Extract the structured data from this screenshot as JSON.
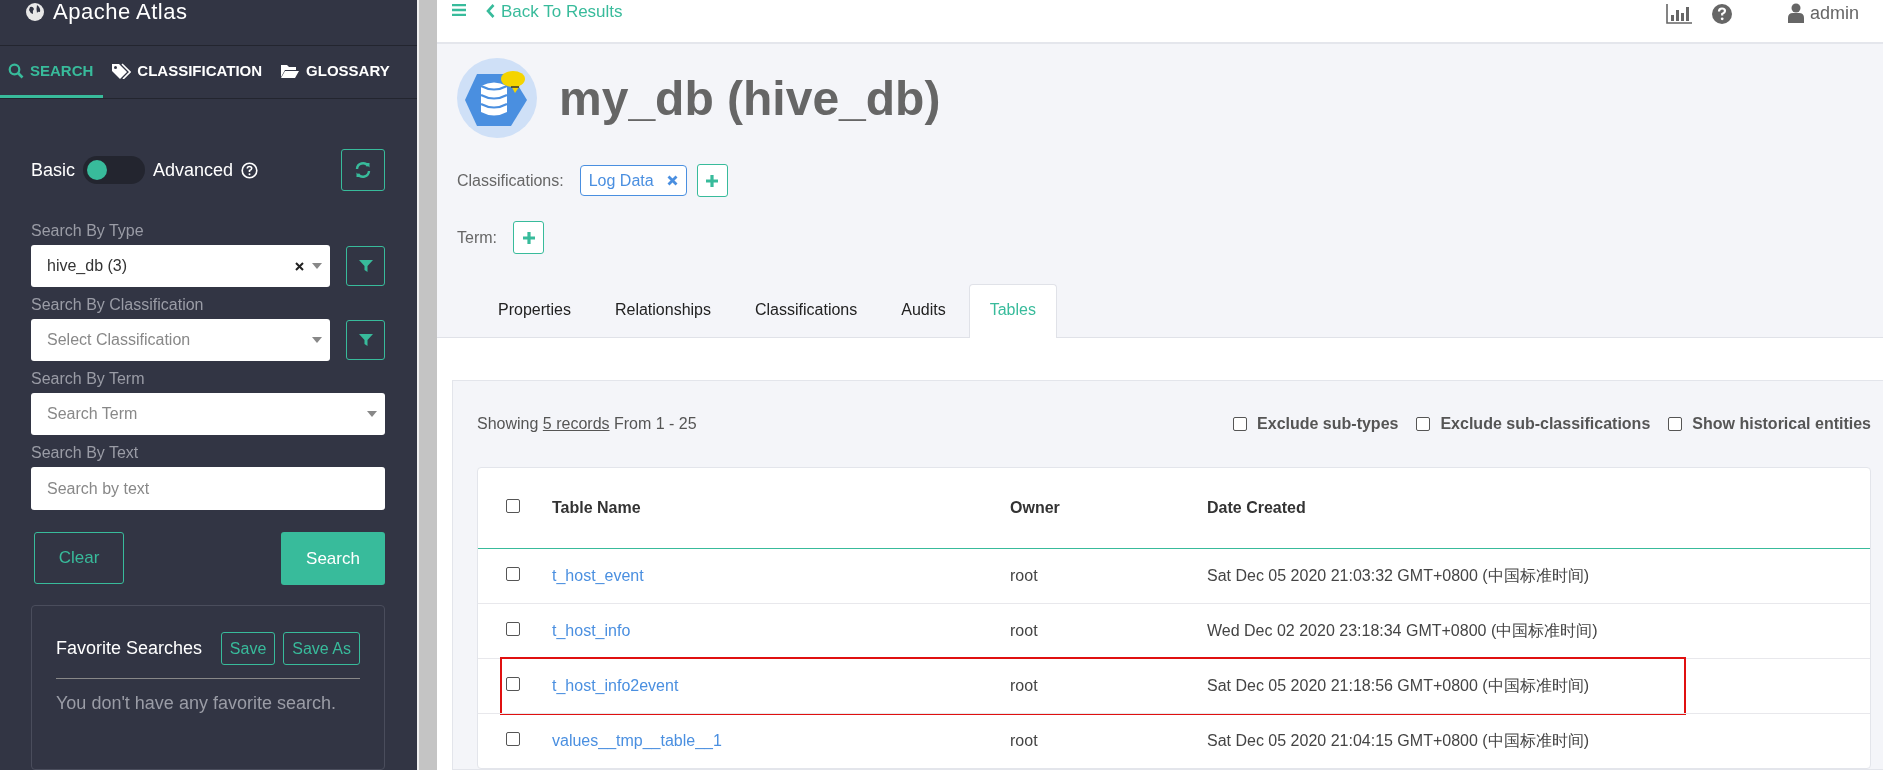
{
  "app": {
    "title": "Apache Atlas"
  },
  "sidebar_tabs": [
    {
      "label": "SEARCH",
      "kind": "search",
      "selected": true
    },
    {
      "label": "CLASSIFICATION",
      "kind": "tag",
      "selected": false
    },
    {
      "label": "GLOSSARY",
      "kind": "folder",
      "selected": false
    }
  ],
  "search_mode": {
    "left": "Basic",
    "right": "Advanced",
    "on": false
  },
  "filters": [
    {
      "label": "Search By Type",
      "kind": "select",
      "value": "hive_db (3)",
      "clearable": true,
      "filter_button": true
    },
    {
      "label": "Search By Classification",
      "kind": "select",
      "placeholder": "Select Classification",
      "clearable": false,
      "filter_button": true
    },
    {
      "label": "Search By Term",
      "kind": "select",
      "placeholder": "Search Term",
      "clearable": false,
      "filter_button": false
    },
    {
      "label": "Search By Text",
      "kind": "text",
      "placeholder": "Search by text",
      "filter_button": false
    }
  ],
  "actions": {
    "clear": "Clear",
    "search": "Search"
  },
  "favorites": {
    "title": "Favorite Searches",
    "save": "Save",
    "save_as": "Save As",
    "empty": "You don't have any favorite search."
  },
  "header": {
    "back": "Back To Results",
    "user": "admin"
  },
  "entity": {
    "title": "my_db (hive_db)",
    "classifications_label": "Classifications:",
    "classifications": [
      "Log Data"
    ],
    "term_label": "Term:"
  },
  "detail_tabs": [
    {
      "label": "Properties",
      "selected": false
    },
    {
      "label": "Relationships",
      "selected": false
    },
    {
      "label": "Classifications",
      "selected": false
    },
    {
      "label": "Audits",
      "selected": false
    },
    {
      "label": "Tables",
      "selected": true
    }
  ],
  "records": {
    "prefix": "Showing",
    "count": "5 records",
    "suffix": "From 1 - 25"
  },
  "options": [
    {
      "label": "Exclude sub-types",
      "checked": false
    },
    {
      "label": "Exclude sub-classifications",
      "checked": false
    },
    {
      "label": "Show historical entities",
      "checked": false
    }
  ],
  "table": {
    "all_checked": false,
    "columns": [
      "Table Name",
      "Owner",
      "Date Created"
    ],
    "rows": [
      {
        "name": "t_host_event",
        "owner": "root",
        "date": "Sat Dec 05 2020 21:03:32 GMT+0800 (中国标准时间)",
        "checked": false,
        "highlighted": false
      },
      {
        "name": "t_host_info",
        "owner": "root",
        "date": "Wed Dec 02 2020 23:18:34 GMT+0800 (中国标准时间)",
        "checked": false,
        "highlighted": false
      },
      {
        "name": "t_host_info2event",
        "owner": "root",
        "date": "Sat Dec 05 2020 21:18:56 GMT+0800 (中国标准时间)",
        "checked": false,
        "highlighted": true
      },
      {
        "name": "values__tmp__table__1",
        "owner": "root",
        "date": "Sat Dec 05 2020 21:04:15 GMT+0800 (中国标准时间)",
        "checked": false,
        "highlighted": false
      }
    ]
  }
}
